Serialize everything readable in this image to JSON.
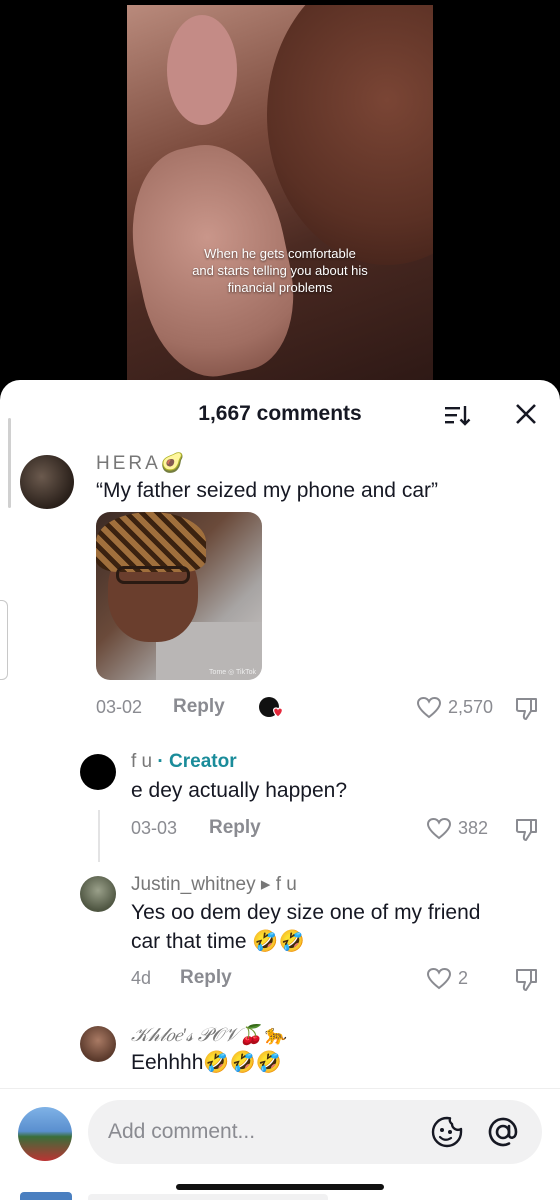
{
  "video": {
    "caption_lines": [
      "When he gets comfortable",
      "and starts telling you about his",
      "financial problems"
    ]
  },
  "sheet": {
    "title": "1,667 comments"
  },
  "comments": [
    {
      "username": "HERA🥑",
      "text": "“My father seized my phone and car”",
      "date": "03-02",
      "reply_label": "Reply",
      "likes": "2,570",
      "has_photo": true,
      "photo_watermark": "Tome ◎ TikTok"
    },
    {
      "username": "f u",
      "badge": "· Creator",
      "text": "e dey actually happen?",
      "date": "03-03",
      "reply_label": "Reply",
      "likes": "382"
    },
    {
      "username": "Justin_whitney",
      "reply_to": "▸ f u",
      "text_lines": [
        "Yes oo dem dey size one of my friend",
        "car that time 🤣🤣"
      ],
      "date": "4d",
      "reply_label": "Reply",
      "likes": "2"
    },
    {
      "username": "𝒦𝒽𝓁𝑜𝑒'𝓈 𝒫𝒪𝒱🍒🐆",
      "text": "Eehhhh🤣🤣🤣"
    }
  ],
  "composer": {
    "placeholder": "Add comment..."
  },
  "icons": [
    "sort-icon",
    "close-icon",
    "heart-icon",
    "dislike-icon",
    "emoji-icon",
    "at-icon"
  ]
}
